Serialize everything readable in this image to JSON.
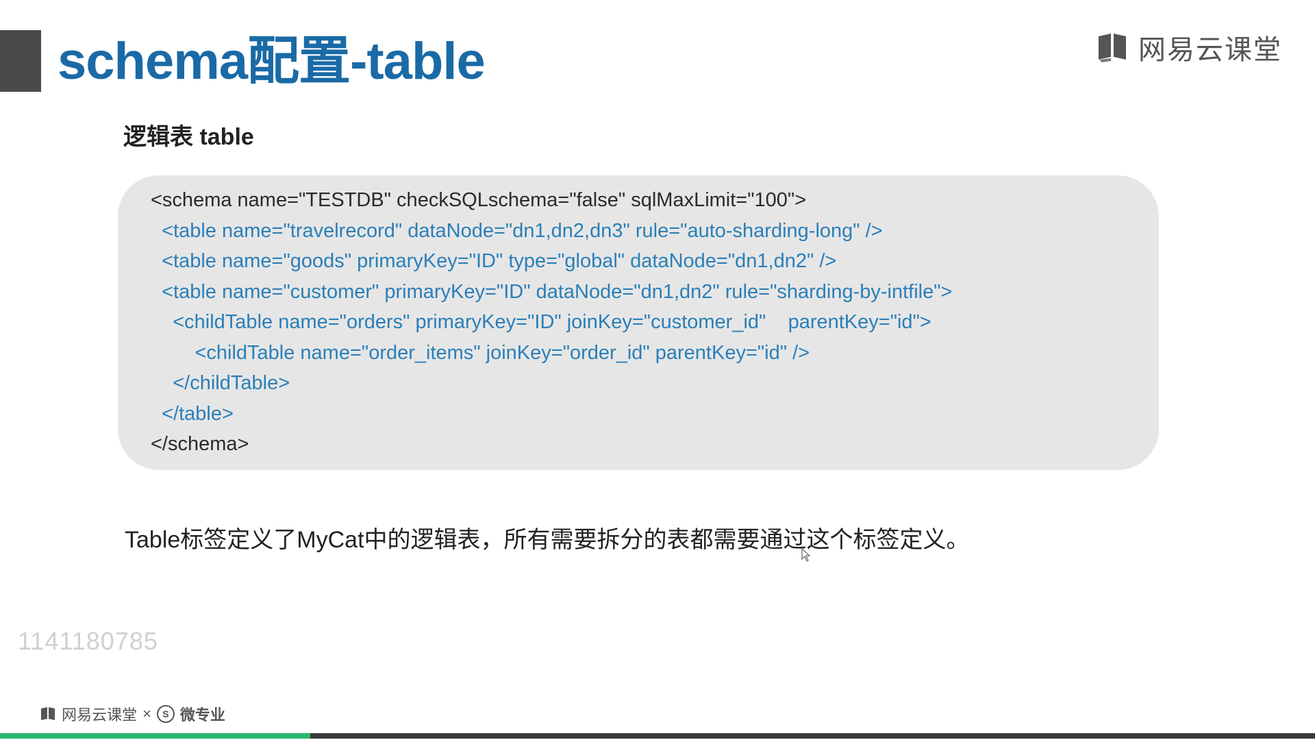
{
  "slide": {
    "title": "schema配置-table",
    "brand": "网易云课堂",
    "subheading": "逻辑表 table",
    "code_lines": [
      "<schema name=\"TESTDB\" checkSQLschema=\"false\" sqlMaxLimit=\"100\">",
      "  <table name=\"travelrecord\" dataNode=\"dn1,dn2,dn3\" rule=\"auto-sharding-long\" />",
      "  <table name=\"goods\" primaryKey=\"ID\" type=\"global\" dataNode=\"dn1,dn2\" />",
      "  <table name=\"customer\" primaryKey=\"ID\" dataNode=\"dn1,dn2\" rule=\"sharding-by-intfile\">",
      "    <childTable name=\"orders\" primaryKey=\"ID\" joinKey=\"customer_id\"    parentKey=\"id\">",
      "        <childTable name=\"order_items\" joinKey=\"order_id\" parentKey=\"id\" />",
      "    </childTable>",
      "  </table>",
      "</schema>"
    ],
    "description": "Table标签定义了MyCat中的逻辑表，所有需要拆分的表都需要通过这个标签定义。",
    "watermark_id": "1141180785"
  },
  "footer": {
    "brand": "网易云课堂",
    "separator": "×",
    "partner_symbol": "S",
    "partner": "微专业"
  },
  "player": {
    "progress_fraction": 0.236
  },
  "colors": {
    "title": "#1a6aa6",
    "code_accent": "#2a7fb8",
    "code_dark": "#2a2a2a",
    "code_panel": "#e6e6e6",
    "progress_fill": "#2bb673",
    "progress_track": "#3a3a3a"
  },
  "icons": {
    "brand": "book-icon",
    "cursor": "mouse-pointer-icon"
  }
}
